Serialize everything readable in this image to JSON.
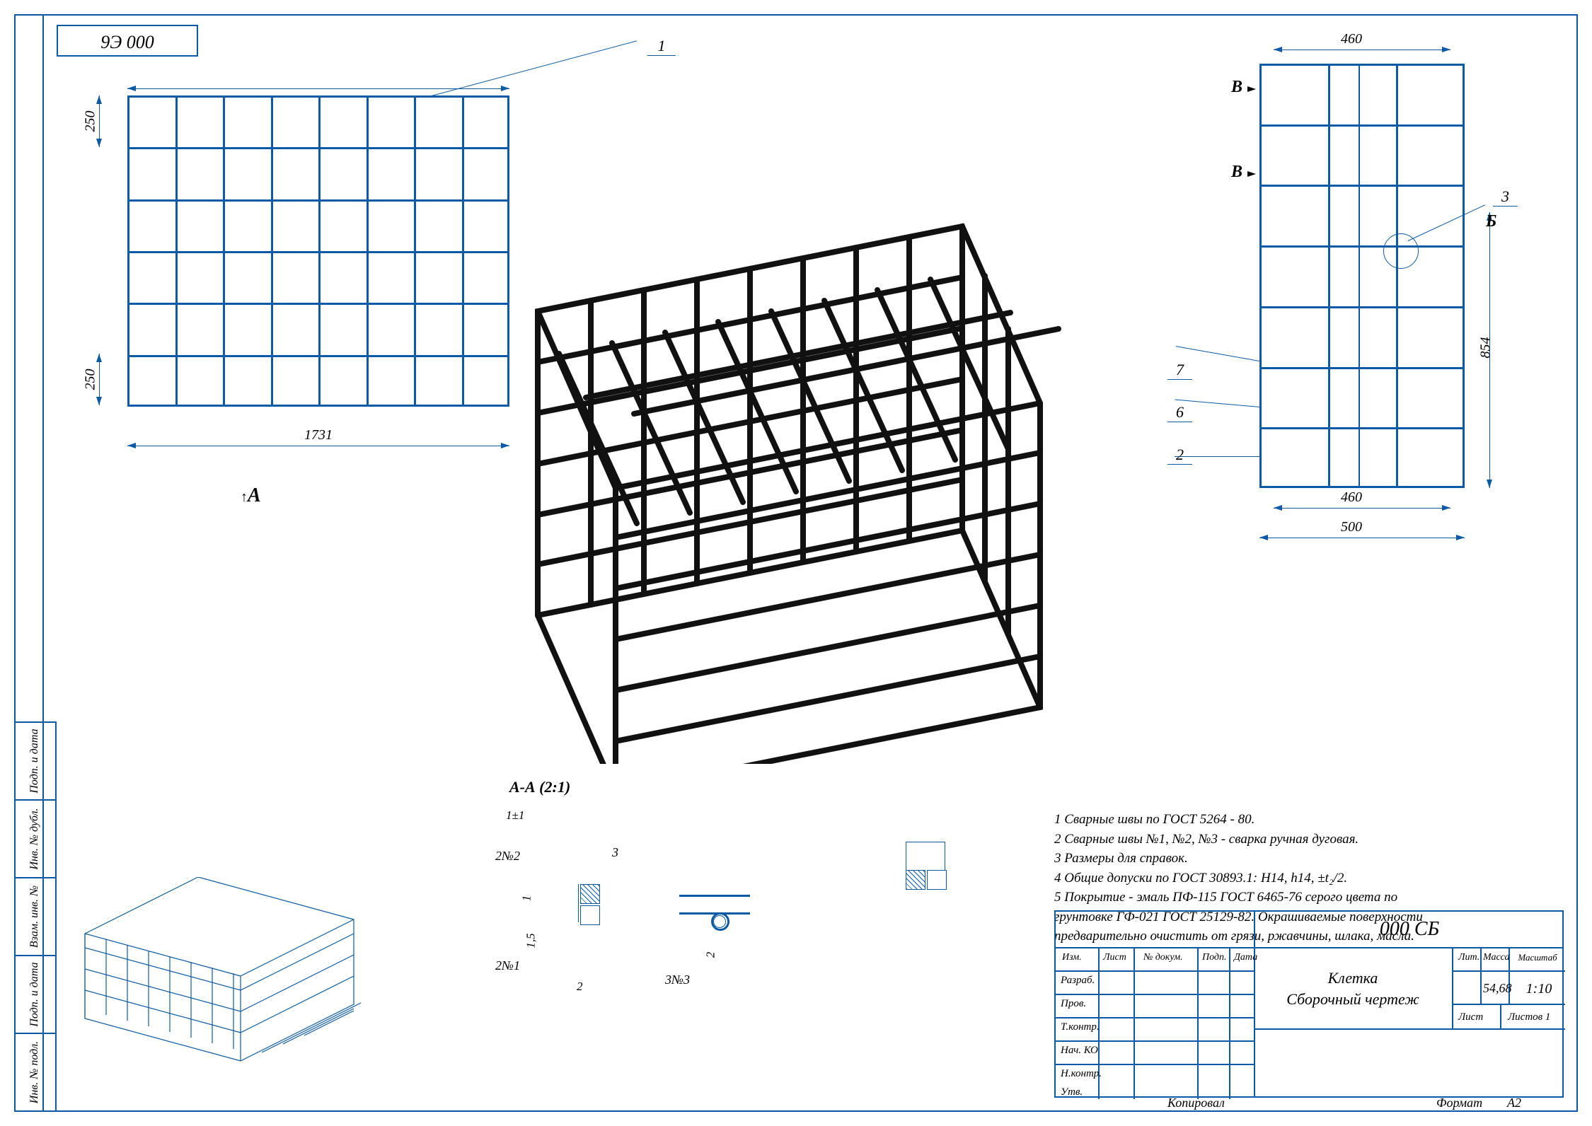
{
  "header_code": "9Э 000",
  "dimensions": {
    "front": {
      "top_cell": "250",
      "left_cell": "250",
      "bottom": "1731"
    },
    "side": {
      "top": "460",
      "bottom1": "460",
      "bottom2": "500",
      "right": "854"
    }
  },
  "markers": {
    "m1": "1",
    "m2": "2",
    "m3": "3",
    "m6": "6",
    "m7": "7",
    "B": "Б",
    "V": "В"
  },
  "arrow_label": "А",
  "section_label": "А-А (2:1)",
  "detail": {
    "weld1": "2№1",
    "weld2": "2№2",
    "weld3": "3№3",
    "t1": "1",
    "t2": "1,5",
    "t3": "2",
    "t4": "2",
    "th": "1±1",
    "n3": "3"
  },
  "notes": {
    "l1": "1 Сварные швы по ГОСТ 5264 - 80.",
    "l2": "2 Сварные швы №1, №2, №3 - сварка ручная дуговая.",
    "l3": "3 Размеры для справок.",
    "l4": "4 Общие допуски по ГОСТ 30893.1: H14, h14, ±t₂/2.",
    "l5a": "5 Покрытие - эмаль ПФ-115  ГОСТ 6465-76 серого цвета по",
    "l5b": "грунтовке ГФ-021 ГОСТ 25129-82. Окрашиваемые поверхности",
    "l5c": "предварительно очистить от грязи, ржавчины, шлака, масла."
  },
  "titleblock": {
    "code": "000 СБ",
    "name1": "Клетка",
    "name2": "Сборочный чертеж",
    "mass": "54,68",
    "scale": "1:10",
    "mass_h": "Масса",
    "scale_h": "Масштаб",
    "lit_h": "Лит.",
    "sheet": "Лист",
    "sheets": "Листов   1",
    "izm": "Изм.",
    "list": "Лист",
    "ndoc": "№ докум.",
    "podp": "Подп.",
    "data": "Дата",
    "razrab": "Разраб.",
    "prov": "Пров.",
    "tkontr": "Т.контр.",
    "nachko": "Нач. КО",
    "nkontr": "Н.контр.",
    "utv": "Утв.",
    "kopiroval": "Копировал",
    "format": "Формат",
    "format_v": "А2"
  },
  "sidebar": {
    "c1": "Инв. № подл.",
    "c2": "Подп. и дата",
    "c3": "Взам. инв. №",
    "c4": "Инв. № дубл.",
    "c5": "Подп. и дата"
  }
}
